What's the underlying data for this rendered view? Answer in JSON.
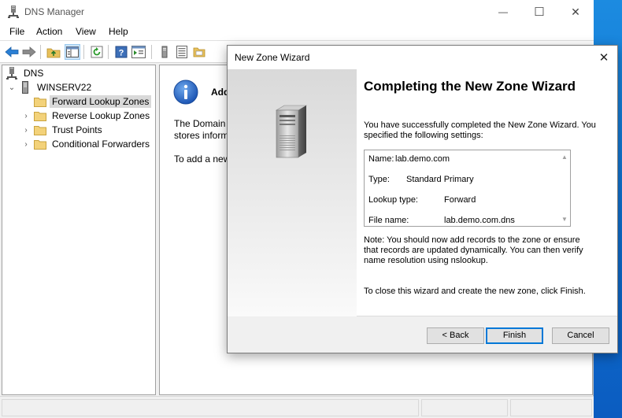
{
  "window": {
    "title": "DNS Manager",
    "minimize_glyph": "—",
    "maximize_glyph": "☐",
    "close_glyph": "✕"
  },
  "menu": {
    "items": [
      "File",
      "Action",
      "View",
      "Help"
    ]
  },
  "toolbar": {
    "icons": [
      "back-arrow-icon",
      "forward-arrow-icon",
      "up-folder-icon",
      "show-hide-tree-icon",
      "refresh-icon",
      "help-icon",
      "properties-icon",
      "server-icon",
      "list-icon",
      "folder-view-icon"
    ]
  },
  "tree": {
    "root": "DNS",
    "server": "WINSERV22",
    "children": [
      {
        "label": "Forward Lookup Zones",
        "selected": true
      },
      {
        "label": "Reverse Lookup Zones",
        "selected": false
      },
      {
        "label": "Trust Points",
        "selected": false
      },
      {
        "label": "Conditional Forwarders",
        "selected": false
      }
    ],
    "expander_collapsed": "›",
    "expander_expanded": "⌄"
  },
  "right_pane": {
    "heading_partial": "Add",
    "text_line1": "The Domain",
    "text_line2": "stores inform",
    "text_line3": "To add a new"
  },
  "wizard": {
    "title": "New Zone Wizard",
    "close_glyph": "✕",
    "heading": "Completing the New Zone Wizard",
    "intro": "You have successfully completed the New Zone Wizard. You specified the following settings:",
    "settings": [
      {
        "key": "Name:",
        "value": "lab.demo.com"
      },
      {
        "key": "Type:",
        "value": "Standard Primary"
      },
      {
        "key": "Lookup type:",
        "value": "Forward"
      },
      {
        "key": "File name:",
        "value": "lab.demo.com.dns"
      }
    ],
    "note": "Note: You should now add records to the zone or ensure that records are updated dynamically. You can then verify name resolution using nslookup.",
    "close_text": "To close this wizard and create the new zone, click Finish.",
    "buttons": {
      "back": "< Back",
      "finish": "Finish",
      "cancel": "Cancel"
    }
  },
  "colors": {
    "accent": "#0078d7",
    "desktop": "#1a78d4",
    "selection": "#d9d9d9"
  }
}
